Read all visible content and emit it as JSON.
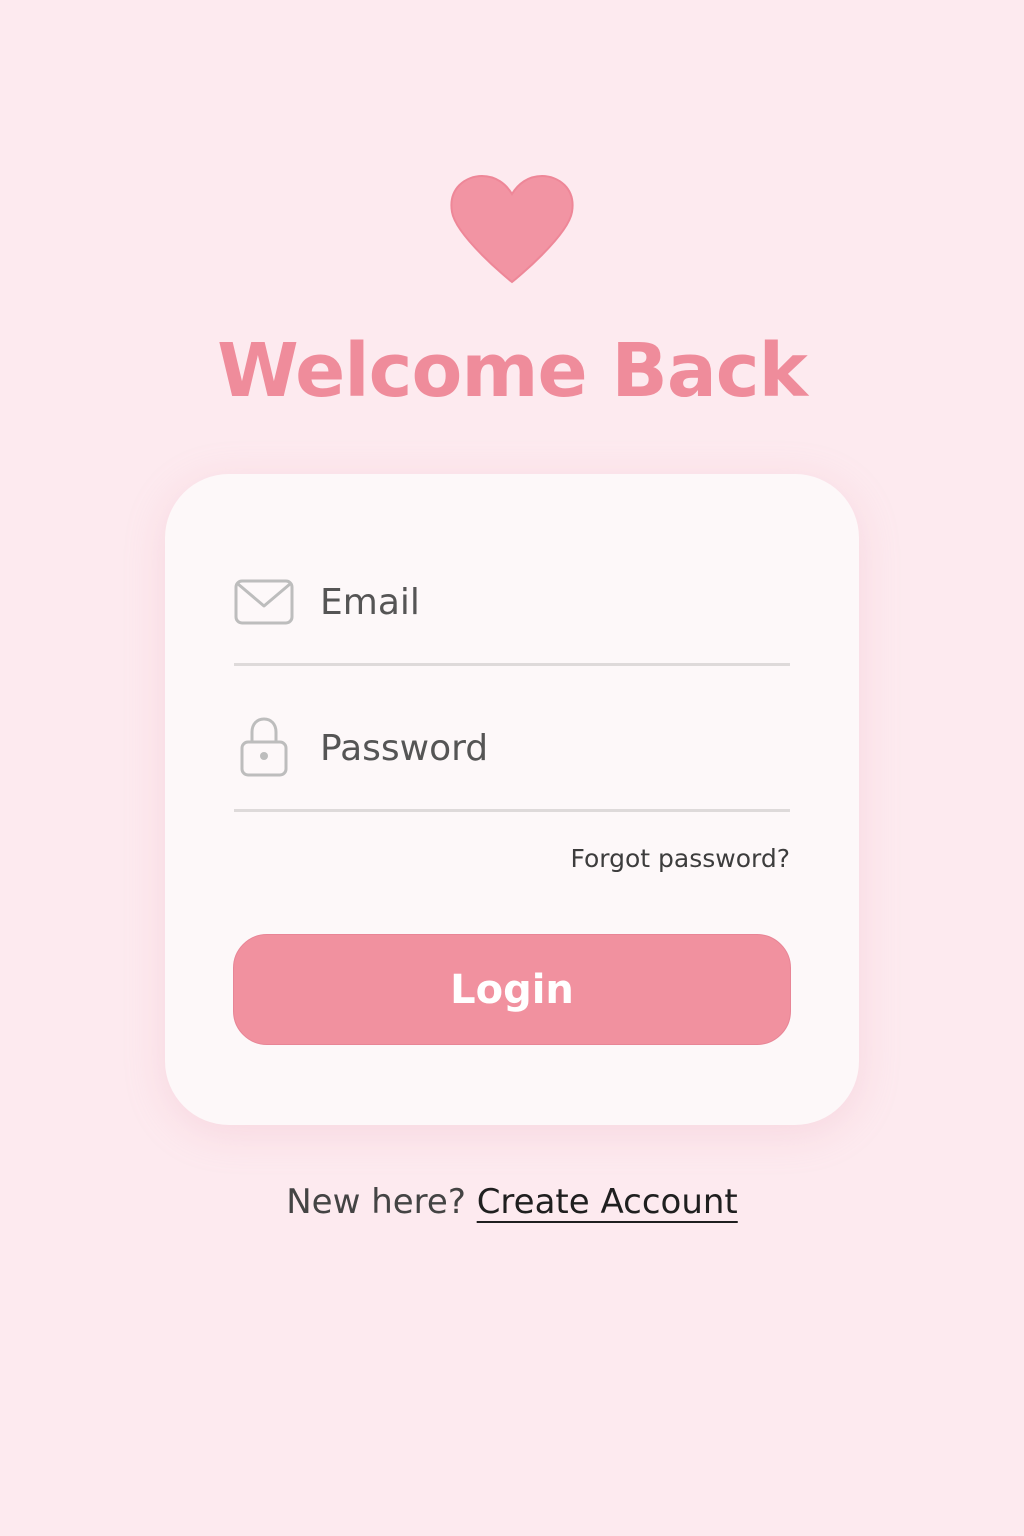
{
  "brand": {
    "logo_icon": "heart-icon",
    "accent_color": "#ef8c9b"
  },
  "header": {
    "title": "Welcome Back"
  },
  "form": {
    "email": {
      "icon": "envelope-icon",
      "placeholder": "Email",
      "value": ""
    },
    "password": {
      "icon": "lock-icon",
      "placeholder": "Password",
      "value": ""
    },
    "forgot_password_label": "Forgot password?",
    "login_label": "Login",
    "button_color": "#f1919f"
  },
  "footer": {
    "prompt": "New here?",
    "create_account_label": "Create Account"
  }
}
